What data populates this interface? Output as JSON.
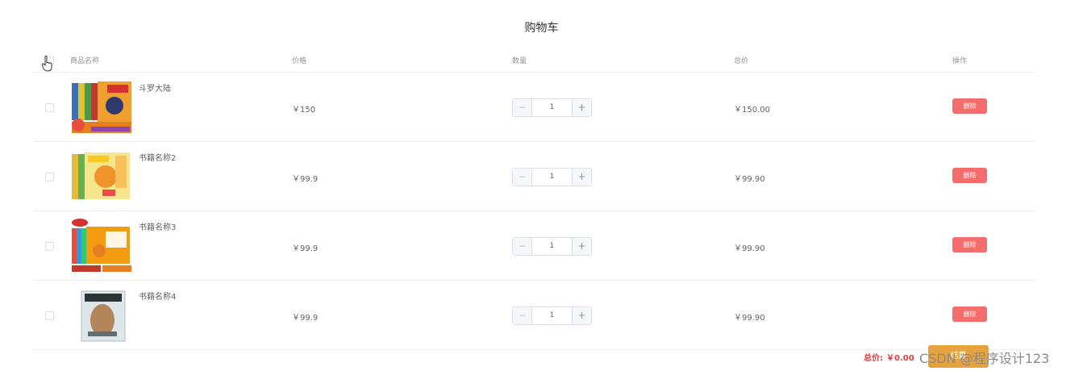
{
  "page": {
    "title": "购物车"
  },
  "header": {
    "name": "商品名称",
    "price": "价格",
    "quantity": "数量",
    "total": "总价",
    "action": "操作"
  },
  "items": [
    {
      "name": "斗罗大陆",
      "price": "￥150",
      "quantity": "1",
      "total": "￥150.00",
      "delete": "删除"
    },
    {
      "name": "书籍名称2",
      "price": "￥99.9",
      "quantity": "1",
      "total": "￥99.90",
      "delete": "删除"
    },
    {
      "name": "书籍名称3",
      "price": "￥99.9",
      "quantity": "1",
      "total": "￥99.90",
      "delete": "删除"
    },
    {
      "name": "书籍名称4",
      "price": "￥99.9",
      "quantity": "1",
      "total": "￥99.90",
      "delete": "删除"
    }
  ],
  "footer": {
    "total_label": "总价:",
    "total_value": "￥0.00",
    "checkout": "结算",
    "watermark": "CSDN @程序设计123"
  },
  "colors": {
    "danger": "#f56c6c",
    "warning": "#e6a23c",
    "price_red": "#e4393c"
  }
}
